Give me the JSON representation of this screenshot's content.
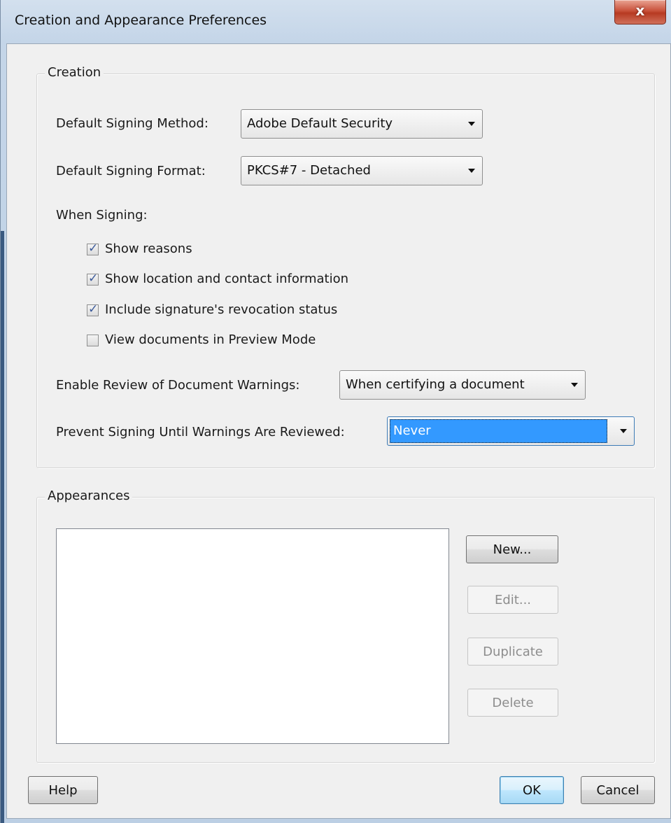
{
  "window": {
    "title": "Creation and Appearance Preferences",
    "close_glyph": "x"
  },
  "creation": {
    "group_label": "Creation",
    "signing_method_label": "Default Signing Method:",
    "signing_method_value": "Adobe Default Security",
    "signing_format_label": "Default Signing Format:",
    "signing_format_value": "PKCS#7 - Detached",
    "when_signing_label": "When Signing:",
    "checkboxes": [
      {
        "label": "Show reasons",
        "checked": true
      },
      {
        "label": "Show location and contact information",
        "checked": true
      },
      {
        "label": "Include signature's revocation status",
        "checked": true
      },
      {
        "label": "View documents in Preview Mode",
        "checked": false
      }
    ],
    "review_warnings_label": "Enable Review of Document Warnings:",
    "review_warnings_value": "When certifying a document",
    "prevent_signing_label": "Prevent Signing Until Warnings Are Reviewed:",
    "prevent_signing_value": "Never"
  },
  "appearances": {
    "group_label": "Appearances",
    "new_label": "New...",
    "edit_label": "Edit...",
    "duplicate_label": "Duplicate",
    "delete_label": "Delete"
  },
  "footer": {
    "help_label": "Help",
    "ok_label": "OK",
    "cancel_label": "Cancel"
  },
  "colors": {
    "selection": "#3399ff",
    "default_button": "#bee6fd",
    "close_button": "#c9523c"
  }
}
